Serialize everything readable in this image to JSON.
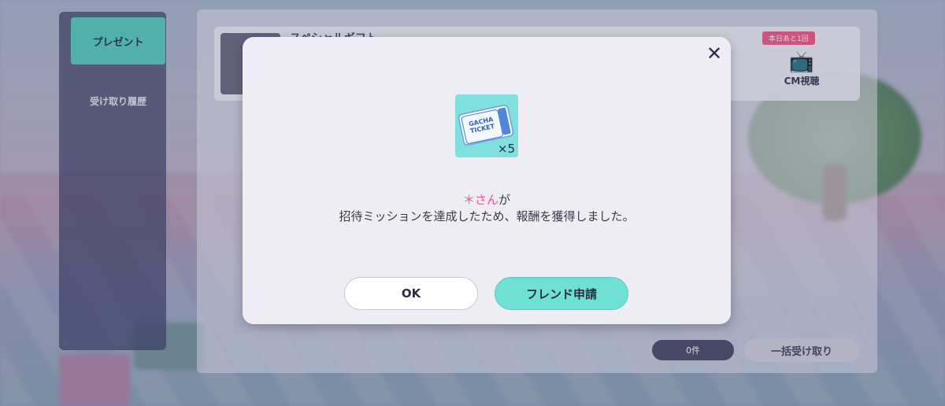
{
  "background": {
    "side_tabs": [
      {
        "label": "プレゼント",
        "active": true
      },
      {
        "label": "受け取り履歴",
        "active": false
      }
    ],
    "row": {
      "title": "スペシャルギフト",
      "badge": "本日あと1回",
      "cm_label": "CM視聴"
    },
    "count_label": "0件",
    "receive_all_label": "一括受け取り"
  },
  "modal": {
    "close_symbol": "✕",
    "reward": {
      "icon": "gacha-ticket-icon",
      "ticket_text_line1": "GACHA",
      "ticket_text_line2": "TICKET",
      "quantity": "×5"
    },
    "message": {
      "name": "＊さん",
      "name_suffix": "が",
      "body": "招待ミッションを達成したため、報酬を獲得しました。"
    },
    "buttons": {
      "ok_label": "OK",
      "friend_label": "フレンド申請"
    }
  },
  "colors": {
    "accent_teal": "#6fe1d4",
    "name_pink": "#f0508a",
    "modal_bg": "#eeedf4"
  }
}
